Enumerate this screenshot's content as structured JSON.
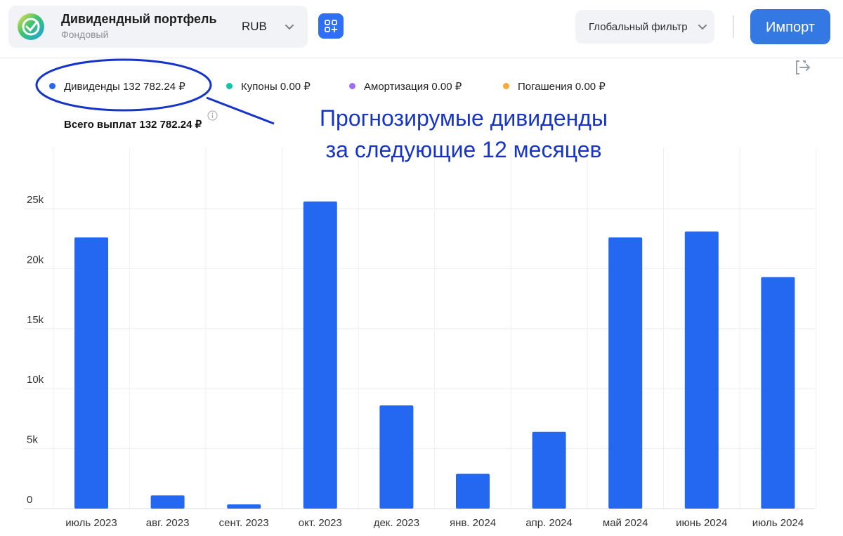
{
  "header": {
    "portfolio_title": "Дивидендный портфель",
    "portfolio_type": "Фондовый",
    "currency": "RUB",
    "global_filter_label": "Глобальный фильтр",
    "import_label": "Импорт",
    "accent_color": "#3478e4",
    "logo_icon": "sber-logo-icon",
    "apps_icon": "apps-add-icon",
    "chevron_icon": "chevron-down-icon",
    "export_icon": "export-icon"
  },
  "legend": [
    {
      "label": "Дивиденды 132 782.24 ₽",
      "color": "#2468f2"
    },
    {
      "label": "Купоны 0.00 ₽",
      "color": "#19c3a8"
    },
    {
      "label": "Амортизация 0.00 ₽",
      "color": "#a06cf0"
    },
    {
      "label": "Погашения 0.00 ₽",
      "color": "#f2aa3a"
    }
  ],
  "total_label": "Всего выплат 132 782.24 ₽",
  "annotation": {
    "line1": "Прогнозирумые дивиденды",
    "line2": "за следующие 12 месяцев",
    "color": "#1734c8"
  },
  "chart_data": {
    "type": "bar",
    "categories": [
      "июль 2023",
      "авг. 2023",
      "сент. 2023",
      "окт. 2023",
      "дек. 2023",
      "янв. 2024",
      "апр. 2024",
      "май 2024",
      "июнь 2024",
      "июль 2024"
    ],
    "series": [
      {
        "name": "Дивиденды",
        "color": "#2468f2",
        "values": [
          22600,
          1100,
          350,
          25600,
          8600,
          2900,
          6400,
          22600,
          23100,
          19300
        ]
      }
    ],
    "ylim": [
      0,
      25000
    ],
    "yticks": [
      0,
      5000,
      10000,
      15000,
      20000,
      25000
    ],
    "ytick_labels": [
      "0",
      "5k",
      "10k",
      "15k",
      "20k",
      "25k"
    ],
    "grid": true,
    "legend_position": "top-left"
  }
}
